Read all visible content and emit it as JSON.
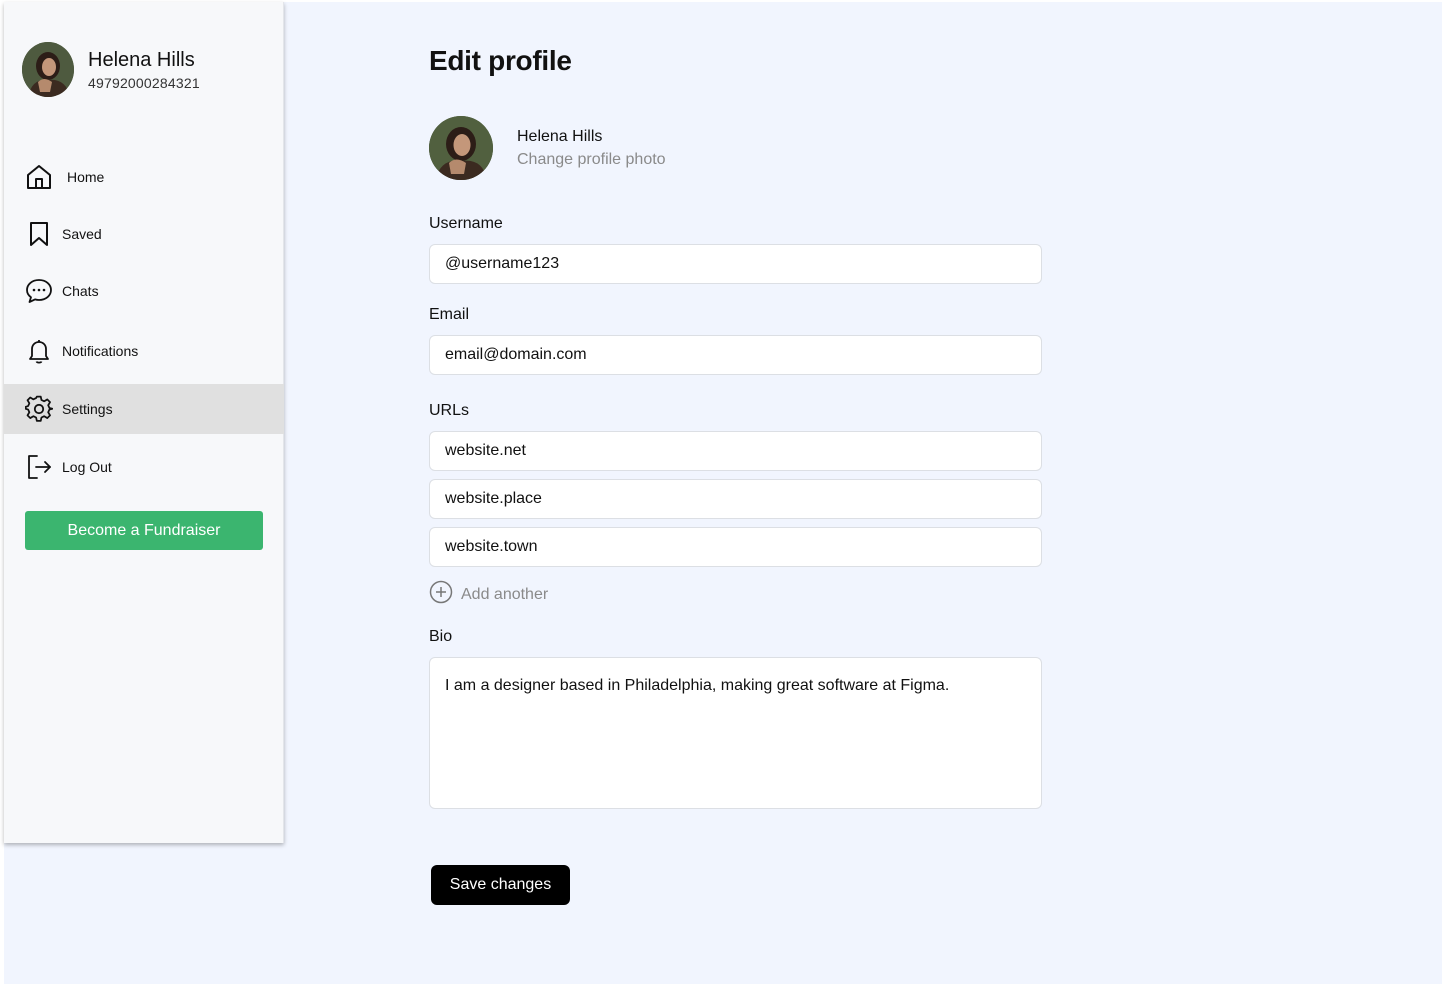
{
  "sidebar": {
    "user_name": "Helena Hills",
    "user_id": "49792000284321",
    "items": [
      {
        "label": "Home",
        "icon": "home-icon"
      },
      {
        "label": "Saved",
        "icon": "bookmark-icon"
      },
      {
        "label": "Chats",
        "icon": "chat-icon"
      },
      {
        "label": "Notifications",
        "icon": "bell-icon"
      },
      {
        "label": "Settings",
        "icon": "gear-icon",
        "active": true
      },
      {
        "label": "Log Out",
        "icon": "logout-icon"
      }
    ],
    "cta_label": "Become a Fundraiser"
  },
  "main": {
    "title": "Edit profile",
    "photo": {
      "name": "Helena Hills",
      "change_label": "Change profile photo"
    },
    "username": {
      "label": "Username",
      "value": "@username123"
    },
    "email": {
      "label": "Email",
      "value": "email@domain.com"
    },
    "urls": {
      "label": "URLs",
      "values": [
        "website.net",
        "website.place",
        "website.town"
      ],
      "add_label": "Add another"
    },
    "bio": {
      "label": "Bio",
      "value": "I am a designer based in Philadelphia, making great software at Figma."
    },
    "save_label": "Save changes"
  },
  "colors": {
    "page_bg": "#f1f5fe",
    "accent_green": "#3bb56f",
    "active_nav_bg": "#e0e0e0",
    "primary_button": "#000000"
  }
}
